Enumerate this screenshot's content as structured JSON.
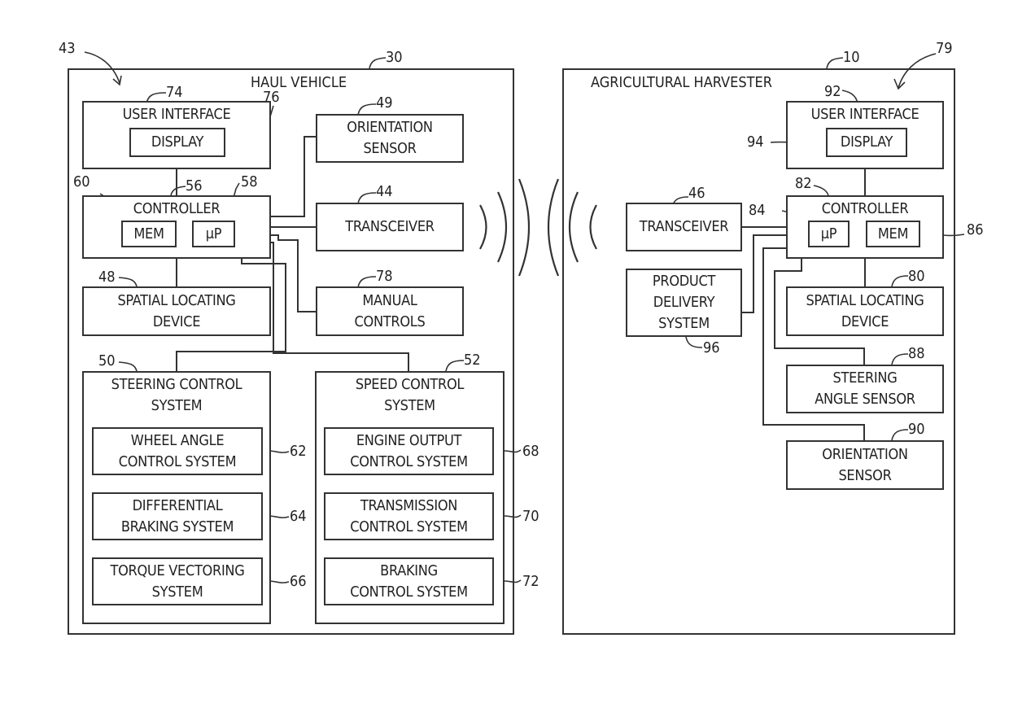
{
  "haul_vehicle": {
    "title": "HAUL VEHICLE",
    "ref": "30",
    "system_ref": "43",
    "user_interface": {
      "label": "USER INTERFACE",
      "ref": "74"
    },
    "display": {
      "label": "DISPLAY",
      "ref": "76"
    },
    "controller": {
      "label": "CONTROLLER",
      "ref": "56"
    },
    "mem": {
      "label": "MEM",
      "ref": "60"
    },
    "up": {
      "label": "μP",
      "ref": "58"
    },
    "orientation_sensor": {
      "label": "ORIENTATION\nSENSOR",
      "ref": "49"
    },
    "transceiver": {
      "label": "TRANSCEIVER",
      "ref": "44"
    },
    "spatial_locating_device": {
      "label": "SPATIAL LOCATING\nDEVICE",
      "ref": "48"
    },
    "manual_controls": {
      "label": "MANUAL\nCONTROLS",
      "ref": "78"
    },
    "steering_control_system": {
      "label": "STEERING CONTROL\nSYSTEM",
      "ref": "50",
      "subsystems": [
        {
          "label": "WHEEL ANGLE\nCONTROL SYSTEM",
          "ref": "62"
        },
        {
          "label": "DIFFERENTIAL\nBRAKING SYSTEM",
          "ref": "64"
        },
        {
          "label": "TORQUE VECTORING\nSYSTEM",
          "ref": "66"
        }
      ]
    },
    "speed_control_system": {
      "label": "SPEED CONTROL\nSYSTEM",
      "ref": "52",
      "subsystems": [
        {
          "label": "ENGINE OUTPUT\nCONTROL SYSTEM",
          "ref": "68"
        },
        {
          "label": "TRANSMISSION\nCONTROL SYSTEM",
          "ref": "70"
        },
        {
          "label": "BRAKING\nCONTROL SYSTEM",
          "ref": "72"
        }
      ]
    }
  },
  "agricultural_harvester": {
    "title": "AGRICULTURAL HARVESTER",
    "ref": "10",
    "system_ref": "79",
    "user_interface": {
      "label": "USER INTERFACE",
      "ref": "92"
    },
    "display": {
      "label": "DISPLAY",
      "ref": "94"
    },
    "controller": {
      "label": "CONTROLLER",
      "ref": "82"
    },
    "up": {
      "label": "μP",
      "ref": "84"
    },
    "mem": {
      "label": "MEM",
      "ref": "86"
    },
    "transceiver": {
      "label": "TRANSCEIVER",
      "ref": "46"
    },
    "product_delivery_system": {
      "label": "PRODUCT\nDELIVERY\nSYSTEM",
      "ref": "96"
    },
    "spatial_locating_device": {
      "label": "SPATIAL LOCATING\nDEVICE",
      "ref": "80"
    },
    "steering_angle_sensor": {
      "label": "STEERING\nANGLE SENSOR",
      "ref": "88"
    },
    "orientation_sensor": {
      "label": "ORIENTATION\nSENSOR",
      "ref": "90"
    }
  }
}
